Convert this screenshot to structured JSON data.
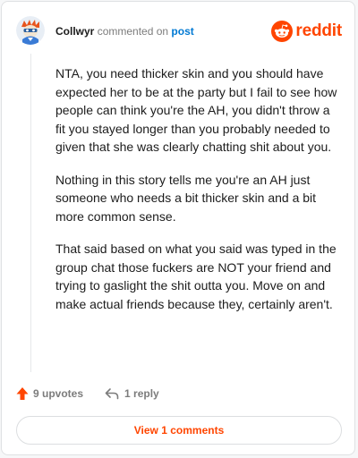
{
  "comment": {
    "username": "Collwyr",
    "action_text": "commented on",
    "post_link": "post",
    "paragraphs": [
      "NTA, you need thicker skin and you should have expected her to be at the party but I fail to see how people can think you're the AH, you didn't throw a fit you stayed longer than you probably needed to given that she was clearly chatting shit about you.",
      "Nothing in this story tells me you're an AH just someone who needs a bit thicker skin and a bit more common sense.",
      "That said based on what you said was typed in the group chat those fuckers are NOT your friend and trying to gaslight the shit outta you. Move on and make actual friends because they, certainly aren't."
    ]
  },
  "brand": {
    "wordmark": "reddit",
    "color": "#ff4500",
    "logo_icon": "reddit-snoo-icon"
  },
  "actions": {
    "upvotes_label": "9 upvotes",
    "reply_label": "1 reply",
    "upvote_icon": "upvote-arrow-icon",
    "reply_icon": "reply-arrow-icon"
  },
  "footer": {
    "view_comments_label": "View 1 comments"
  }
}
